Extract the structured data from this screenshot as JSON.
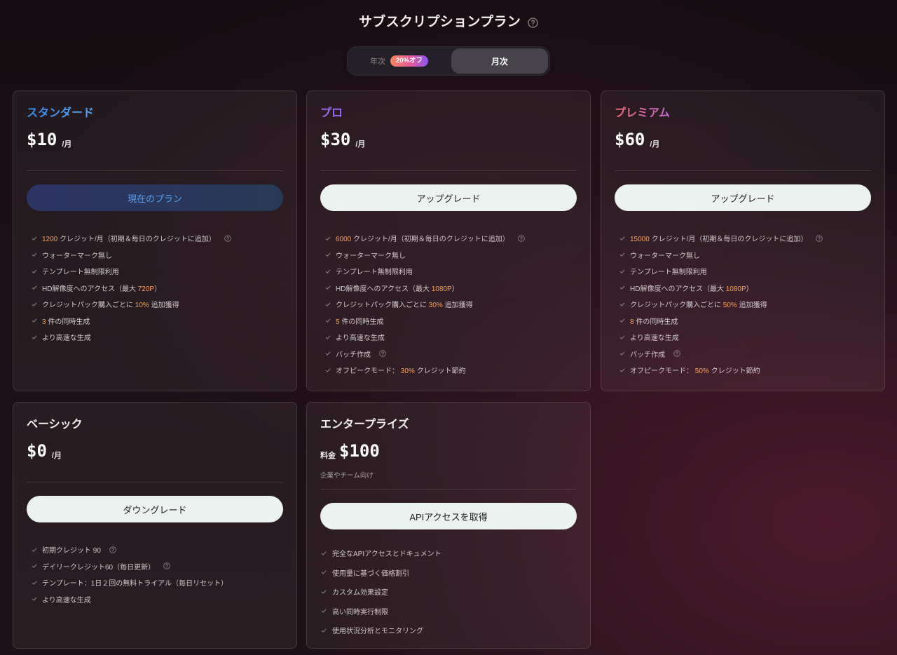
{
  "header": {
    "title": "サブスクリプションプラン",
    "help_icon": "question-circle-icon"
  },
  "billing_toggle": {
    "yearly_label": "年次",
    "yearly_badge": "20%オフ",
    "monthly_label": "月次",
    "monthly_selected": true
  },
  "icons": {
    "feature_bullet": "check-icon",
    "info": "question-circle-icon"
  },
  "colors": {
    "highlight": "#f5a35c",
    "standard_title": "#4596ee",
    "pro_title": "#9b6cf3",
    "premium_title_from": "#f26a76",
    "premium_title_to": "#c06bd2",
    "upgrade_button_bg": "#ebf2f0",
    "current_plan_text": "#5aa2f4",
    "discount_badge_from": "#f7865a",
    "discount_badge_to": "#8f53f0"
  },
  "plans": [
    {
      "name": "スタンダード",
      "price": "$10",
      "period": "/月",
      "button_label": "現在のプラン",
      "is_current": true,
      "features": [
        {
          "hl": "1200",
          "post": " クレジット/月（初期＆毎日のクレジットに追加）",
          "help": true
        },
        {
          "text": "ウォーターマーク無し"
        },
        {
          "text": "テンプレート無制限利用"
        },
        {
          "pre": "HD解像度へのアクセス（最大 ",
          "hl": "720P",
          "post": "）"
        },
        {
          "pre": "クレジットパック購入ごとに ",
          "hl": "10%",
          "post": " 追加獲得"
        },
        {
          "hl": "3",
          "post": " 件の同時生成"
        },
        {
          "text": "より高速な生成"
        }
      ]
    },
    {
      "name": "プロ",
      "price": "$30",
      "period": "/月",
      "button_label": "アップグレード",
      "is_current": false,
      "features": [
        {
          "hl": "6000",
          "post": " クレジット/月（初期＆毎日のクレジットに追加）",
          "help": true
        },
        {
          "text": "ウォーターマーク無し"
        },
        {
          "text": "テンプレート無制限利用"
        },
        {
          "pre": "HD解像度へのアクセス（最大 ",
          "hl": "1080P",
          "post": "）"
        },
        {
          "pre": "クレジットパック購入ごとに ",
          "hl": "30%",
          "post": " 追加獲得"
        },
        {
          "hl": "5",
          "post": " 件の同時生成"
        },
        {
          "text": "より高速な生成"
        },
        {
          "text": "バッチ作成",
          "help": true
        },
        {
          "pre": "オフピークモード： ",
          "hl": "30%",
          "post": " クレジット節約"
        }
      ]
    },
    {
      "name": "プレミアム",
      "price": "$60",
      "period": "/月",
      "button_label": "アップグレード",
      "is_current": false,
      "features": [
        {
          "hl": "15000",
          "post": " クレジット/月（初期＆毎日のクレジットに追加）",
          "help": true
        },
        {
          "text": "ウォーターマーク無し"
        },
        {
          "text": "テンプレート無制限利用"
        },
        {
          "pre": "HD解像度へのアクセス（最大 ",
          "hl": "1080P",
          "post": "）"
        },
        {
          "pre": "クレジットパック購入ごとに ",
          "hl": "50%",
          "post": " 追加獲得"
        },
        {
          "hl": "8",
          "post": " 件の同時生成"
        },
        {
          "text": "より高速な生成"
        },
        {
          "text": "バッチ作成",
          "help": true
        },
        {
          "pre": "オフピークモード： ",
          "hl": "50%",
          "post": " クレジット節約"
        }
      ]
    },
    {
      "name": "ベーシック",
      "price": "$0",
      "period": "/月",
      "button_label": "ダウングレード",
      "is_current": false,
      "features": [
        {
          "text": "初期クレジット 90",
          "help": true
        },
        {
          "text": "デイリークレジット60（毎日更新）",
          "help": true
        },
        {
          "text": "テンプレート：1日２回の無料トライアル（毎日リセット）"
        },
        {
          "text": "より高速な生成"
        }
      ]
    },
    {
      "name": "エンタープライズ",
      "price_prefix": "料金",
      "price": "$100",
      "subtitle": "企業やチーム向け",
      "button_label": "APIアクセスを取得",
      "is_current": false,
      "features": [
        {
          "text": "完全なAPIアクセスとドキュメント"
        },
        {
          "text": "使用量に基づく価格割引"
        },
        {
          "text": "カスタム効果設定"
        },
        {
          "text": "高い同時実行制限"
        },
        {
          "text": "使用状況分析とモニタリング"
        }
      ]
    }
  ]
}
